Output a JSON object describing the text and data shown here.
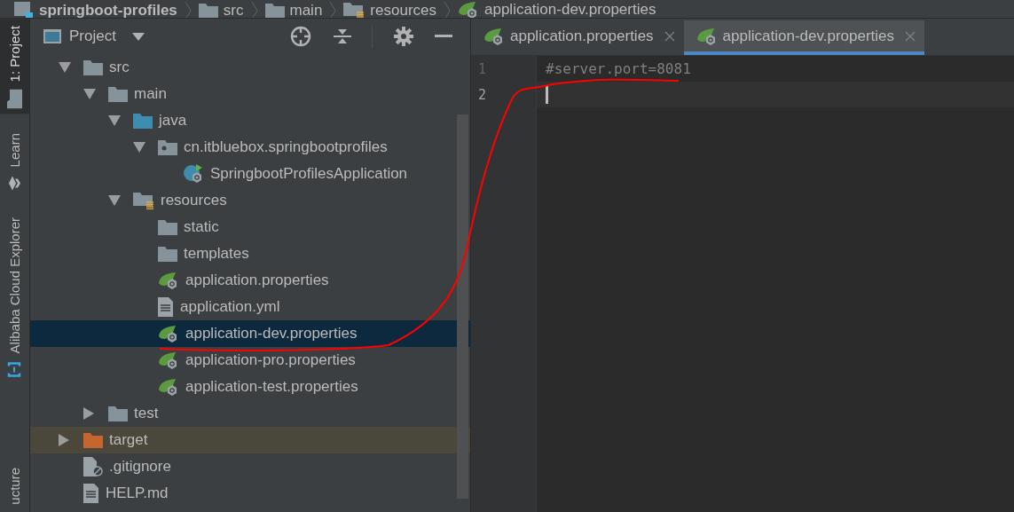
{
  "breadcrumb": [
    {
      "label": "springboot-profiles",
      "kind": "module"
    },
    {
      "label": "src",
      "kind": "folder"
    },
    {
      "label": "main",
      "kind": "folder"
    },
    {
      "label": "resources",
      "kind": "resources-folder"
    },
    {
      "label": "application-dev.properties",
      "kind": "spring-properties"
    }
  ],
  "tool_strip": [
    {
      "label": "1: Project",
      "kind": "folder",
      "selected": true
    },
    {
      "label": "Learn",
      "kind": "cap",
      "selected": false
    },
    {
      "label": "Alibaba Cloud Explorer",
      "kind": "cloud",
      "selected": false
    },
    {
      "label": "ucture",
      "kind": "plain",
      "selected": false
    }
  ],
  "project_panel": {
    "title": "Project",
    "tree": [
      {
        "label": "src",
        "kind": "folder",
        "expanded": true,
        "selected": false,
        "children": [
          {
            "label": "main",
            "kind": "folder",
            "expanded": true,
            "selected": false,
            "children": [
              {
                "label": "java",
                "kind": "source-folder",
                "expanded": true,
                "selected": false,
                "children": [
                  {
                    "label": "cn.itbluebox.springbootprofiles",
                    "kind": "package",
                    "expanded": true,
                    "selected": false,
                    "children": [
                      {
                        "label": "SpringbootProfilesApplication",
                        "kind": "spring-class",
                        "selected": false
                      }
                    ]
                  }
                ]
              },
              {
                "label": "resources",
                "kind": "resources-folder",
                "expanded": true,
                "selected": false,
                "children": [
                  {
                    "label": "static",
                    "kind": "folder",
                    "selected": false
                  },
                  {
                    "label": "templates",
                    "kind": "folder",
                    "selected": false
                  },
                  {
                    "label": "application.properties",
                    "kind": "spring-properties",
                    "selected": false
                  },
                  {
                    "label": "application.yml",
                    "kind": "text-file",
                    "selected": false
                  },
                  {
                    "label": "application-dev.properties",
                    "kind": "spring-properties",
                    "selected": true
                  },
                  {
                    "label": "application-pro.properties",
                    "kind": "spring-properties",
                    "selected": false
                  },
                  {
                    "label": "application-test.properties",
                    "kind": "spring-properties",
                    "selected": false
                  }
                ]
              }
            ]
          },
          {
            "label": "test",
            "kind": "folder",
            "expanded": false,
            "selected": false
          }
        ]
      },
      {
        "label": "target",
        "kind": "excluded-folder",
        "expanded": false,
        "selected": false
      },
      {
        "label": ".gitignore",
        "kind": "ignore-file",
        "selected": false
      },
      {
        "label": "HELP.md",
        "kind": "text-file",
        "selected": false
      }
    ]
  },
  "editor": {
    "tabs": [
      {
        "label": "application.properties",
        "selected": false
      },
      {
        "label": "application-dev.properties",
        "selected": true
      }
    ],
    "lines": [
      {
        "number": "1",
        "text": "#server.port=8081",
        "current": false
      },
      {
        "number": "2",
        "current": true
      }
    ]
  },
  "annotations": [
    {
      "kind": "freehand-stroke"
    }
  ]
}
